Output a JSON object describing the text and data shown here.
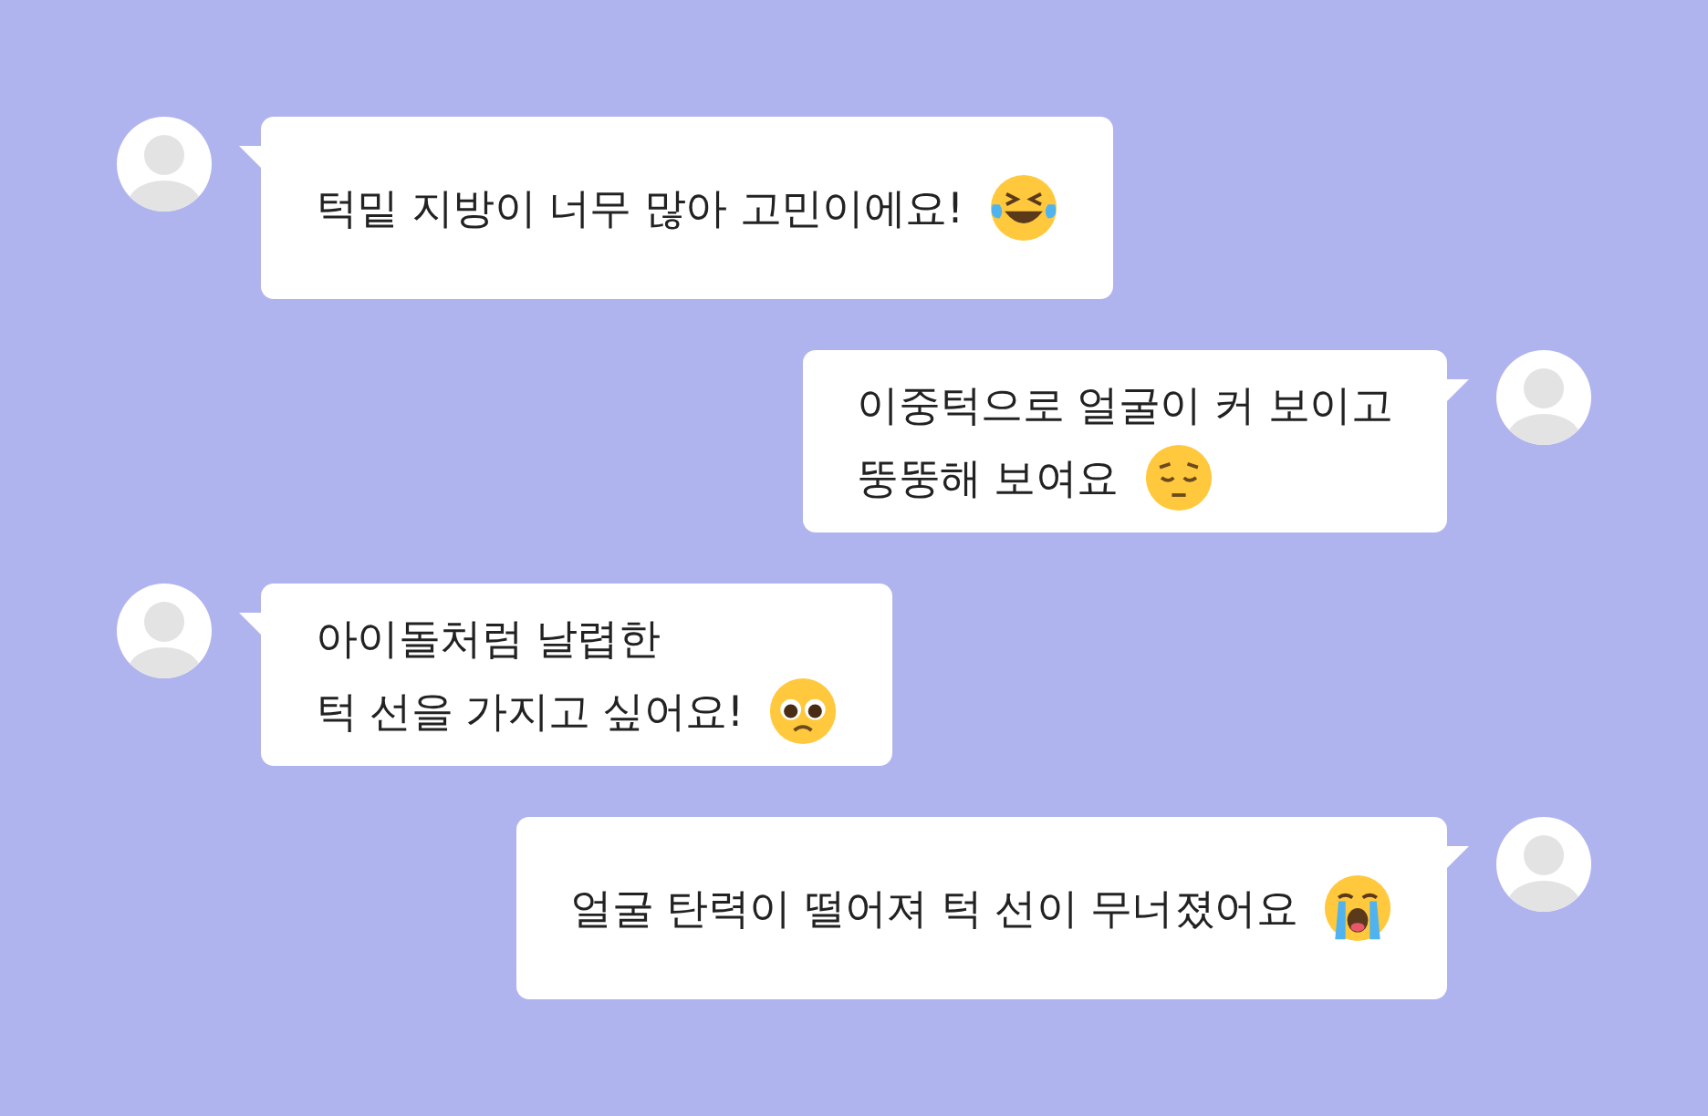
{
  "messages": [
    {
      "outgoing": false,
      "lines": [
        "턱밑 지방이 너무 많아 고민이에요!"
      ]
    },
    {
      "outgoing": true,
      "lines": [
        "이중턱으로 얼굴이 커 보이고",
        "뚱뚱해 보여요"
      ]
    },
    {
      "outgoing": false,
      "lines": [
        "아이돌처럼 날렵한",
        "턱 선을 가지고 싶어요!"
      ]
    },
    {
      "outgoing": true,
      "lines": [
        "얼굴 탄력이 떨어져 턱 선이 무너졌어요"
      ]
    }
  ]
}
